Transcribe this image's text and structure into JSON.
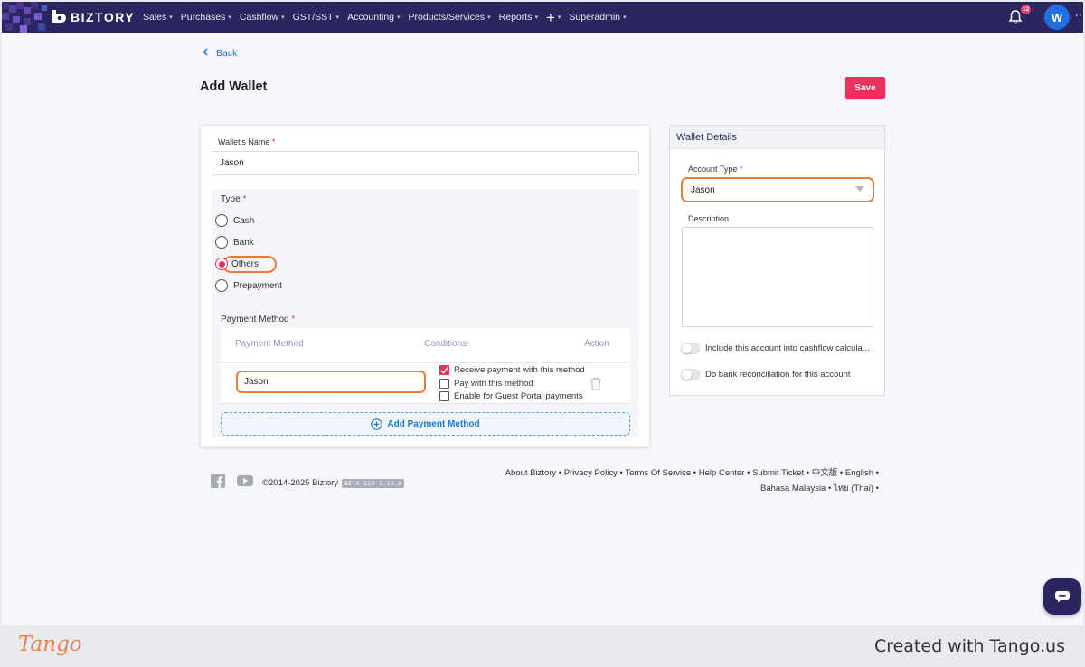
{
  "app": {
    "brand": "BIZTORY"
  },
  "nav": {
    "items": [
      {
        "label": "Sales",
        "caret": "▾"
      },
      {
        "label": "Purchases",
        "caret": "▾"
      },
      {
        "label": "Cashflow",
        "caret": "▾"
      },
      {
        "label": "GST/SST",
        "caret": "▾"
      },
      {
        "label": "Accounting",
        "caret": "▾"
      },
      {
        "label": "Products/Services",
        "caret": "▾"
      },
      {
        "label": "Reports",
        "caret": "▾"
      },
      {
        "label": "+",
        "caret": "▾"
      },
      {
        "label": "Superadmin",
        "caret": "▾"
      }
    ],
    "notification_count": "12",
    "avatar_initial": "W",
    "more_icon": "⋮"
  },
  "header": {
    "back_label": "Back",
    "title": "Add Wallet",
    "save_label": "Save"
  },
  "form": {
    "wallet_name_label": "Wallet's Name",
    "wallet_name_value": "Jason",
    "required_mark": "*",
    "type_label": "Type",
    "type_options": [
      {
        "label": "Cash",
        "selected": false
      },
      {
        "label": "Bank",
        "selected": false
      },
      {
        "label": "Others",
        "selected": true
      },
      {
        "label": "Prepayment",
        "selected": false
      }
    ],
    "payment_method_label": "Payment Method",
    "table_headers": {
      "method": "Payment Method",
      "conditions": "Conditions",
      "action": "Action"
    },
    "payment_row": {
      "method_value": "Jason",
      "conditions": [
        {
          "label": "Receive payment with this method",
          "checked": true
        },
        {
          "label": "Pay with this method",
          "checked": false
        },
        {
          "label": "Enable for Guest Portal payments",
          "checked": false
        }
      ]
    },
    "add_payment_label": "Add Payment Method"
  },
  "details": {
    "title": "Wallet Details",
    "account_type_label": "Account Type",
    "account_type_value": "Jason",
    "description_label": "Description",
    "description_value": "",
    "toggles": [
      {
        "label": "Include this account into cashflow calcula...",
        "on": false
      },
      {
        "label": "Do bank reconciliation for this account",
        "on": false
      }
    ]
  },
  "footer": {
    "copyright": "©2014-2025 Biztory",
    "version": "BETA-123 1.13.0",
    "links_line1": [
      "About Biztory",
      "Privacy Policy",
      "Terms Of Service",
      "Help Center",
      "Submit Ticket",
      "中文版",
      "English"
    ],
    "links_line2": [
      "Bahasa Malaysia",
      "ไทย (Thai)"
    ],
    "separator": " • "
  },
  "tango": {
    "logo": "Tango",
    "credit": "Created with Tango.us"
  },
  "colors": {
    "nav_bg": "#2b2560",
    "accent": "#e8315b",
    "highlight": "#f07a33",
    "link": "#1f78c8"
  }
}
